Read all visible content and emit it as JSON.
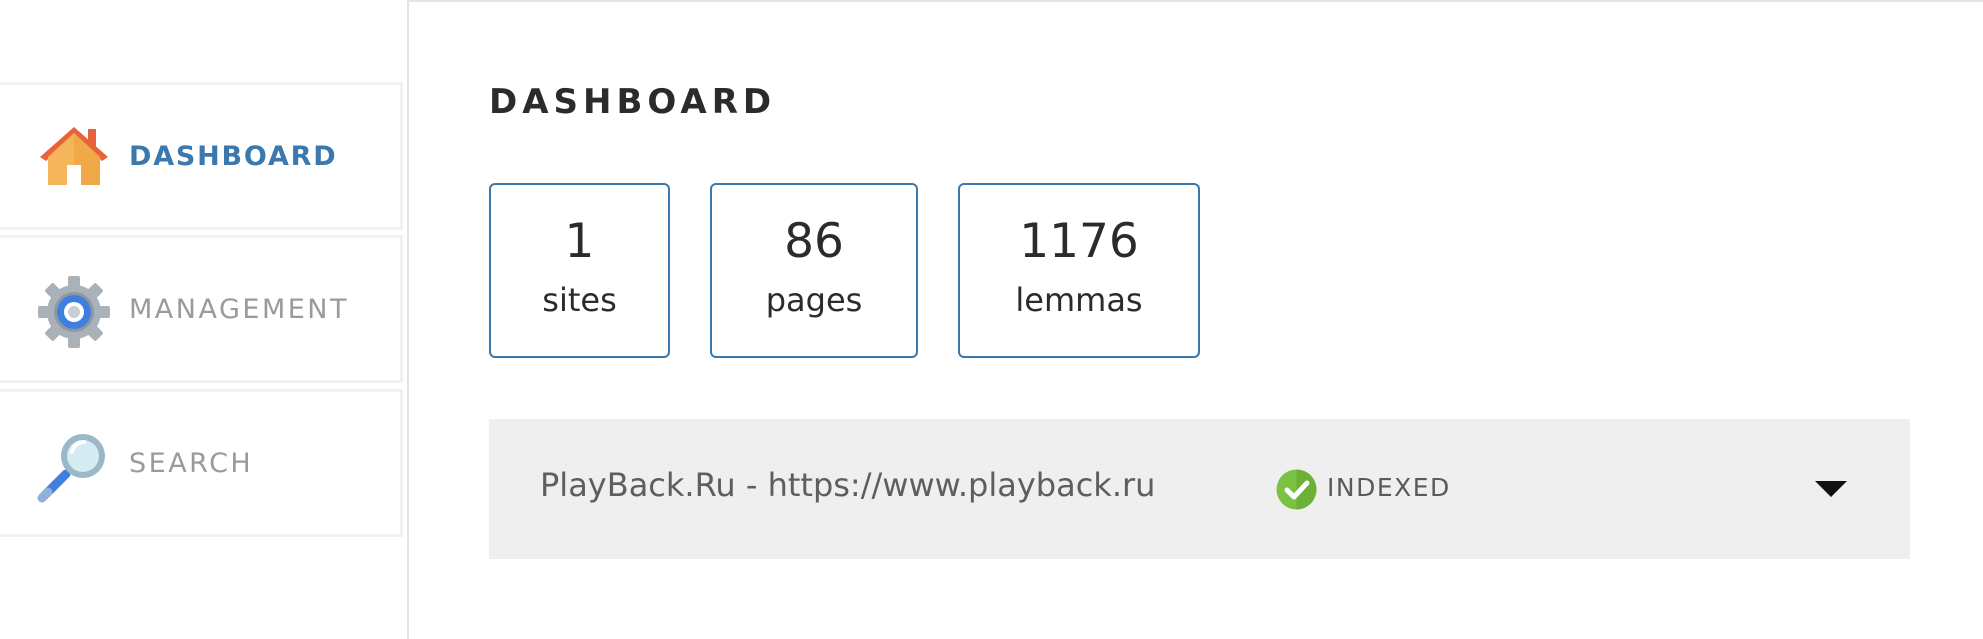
{
  "sidebar": {
    "items": [
      {
        "label": "DASHBOARD",
        "icon": "home-icon",
        "active": true
      },
      {
        "label": "MANAGEMENT",
        "icon": "gear-icon",
        "active": false
      },
      {
        "label": "SEARCH",
        "icon": "magnifier-icon",
        "active": false
      }
    ]
  },
  "main": {
    "title": "DASHBOARD",
    "stats": [
      {
        "value": "1",
        "label": "sites"
      },
      {
        "value": "86",
        "label": "pages"
      },
      {
        "value": "1176",
        "label": "lemmas"
      }
    ],
    "sites": [
      {
        "name": "PlayBack.Ru - https://www.playback.ru",
        "status": "INDEXED",
        "status_icon": "check-circle-icon",
        "expand_icon": "chevron-down-icon"
      }
    ]
  },
  "colors": {
    "accent": "#3a78ad",
    "inactive_text": "#9a9a9a",
    "status_green": "#7cc242",
    "row_background": "#efefef"
  }
}
